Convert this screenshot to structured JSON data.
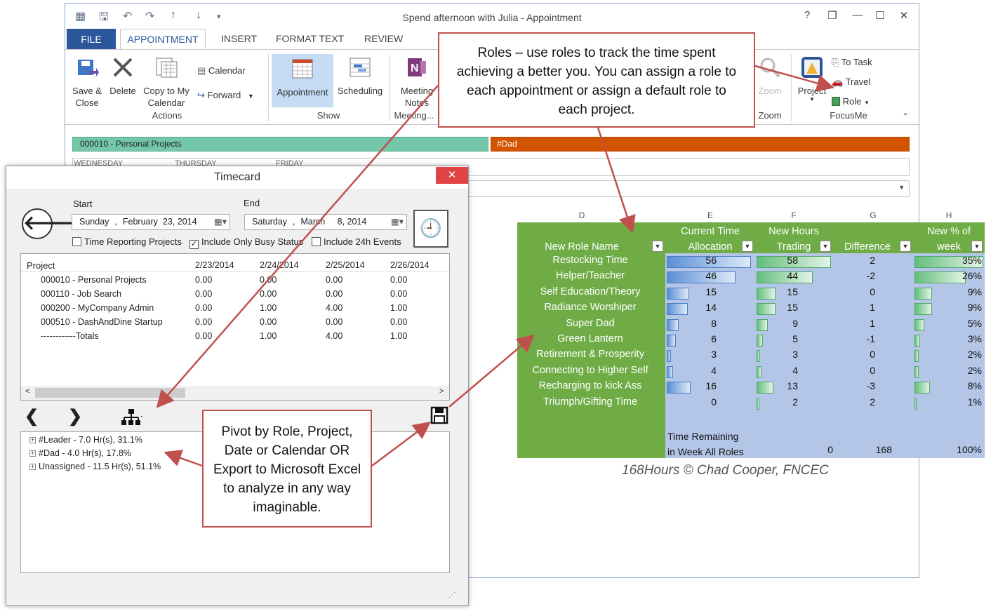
{
  "outlook": {
    "title": "Spend afternoon with Julia - Appointment",
    "tabs": [
      "FILE",
      "APPOINTMENT",
      "INSERT",
      "FORMAT TEXT",
      "REVIEW"
    ],
    "window_controls": [
      "?",
      "❐",
      "—",
      "☐",
      "✕"
    ],
    "ribbon": {
      "save_close": [
        "Save &",
        "Close"
      ],
      "delete": "Delete",
      "copy_to_calendar": [
        "Copy to My",
        "Calendar"
      ],
      "calendar": "Calendar",
      "forward": "Forward",
      "group_actions": "Actions",
      "appointment": "Appointment",
      "scheduling": "Scheduling",
      "group_show": "Show",
      "meeting_notes": [
        "Meeting",
        "Notes"
      ],
      "group_meeting": "Meeting...",
      "zoom_btn": "Zoom",
      "group_zoom": "Zoom",
      "project": "Project",
      "to_task": "To Task",
      "travel": "Travel",
      "role": "Role",
      "group_focusme": "FocusMe"
    },
    "project_bar": "000010 - Personal Projects",
    "role_bar": "#Dad",
    "day_labels": [
      "WEDNESDAY",
      "THURSDAY",
      "FRIDAY"
    ]
  },
  "timecard": {
    "title": "Timecard",
    "start_label": "Start",
    "end_label": "End",
    "start_date": {
      "weekday": "Sunday",
      "month": "February",
      "day": "23, 2014"
    },
    "end_date": {
      "weekday": "Saturday",
      "month": "March",
      "day": "8, 2014"
    },
    "checkboxes": [
      {
        "label": "Time Reporting Projects",
        "checked": false
      },
      {
        "label": "Include Only Busy Status",
        "checked": true
      },
      {
        "label": "Include 24h Events",
        "checked": false
      }
    ],
    "grid": {
      "headers": [
        "Project",
        "2/23/2014",
        "2/24/2014",
        "2/25/2014",
        "2/26/2014"
      ],
      "rows": [
        [
          "000010 - Personal Projects",
          "0.00",
          "0.00",
          "0.00",
          "0.00"
        ],
        [
          "000110 - Job Search",
          "0.00",
          "0.00",
          "0.00",
          "0.00"
        ],
        [
          "000200 - MyCompany Admin",
          "0.00",
          "1.00",
          "4.00",
          "1.00"
        ],
        [
          "000510 - DashAndDine Startup",
          "0.00",
          "0.00",
          "0.00",
          "0.00"
        ],
        [
          "------------Totals",
          "0.00",
          "1.00",
          "4.00",
          "1.00"
        ]
      ]
    },
    "tree": [
      "#Leader - 7.0 Hr(s), 31.1%",
      "#Dad - 4.0 Hr(s), 17.8%",
      "Unassigned - 11.5 Hr(s), 51.1%"
    ]
  },
  "callouts": {
    "roles": "Roles – use roles to track the time spent achieving a better you.  You can assign a role to each appointment or assign a default role to each project.",
    "pivot": "Pivot by Role, Project, Date or Calendar OR Export to Microsoft Excel to analyze in any way imaginable."
  },
  "excel": {
    "columns": [
      "D",
      "E",
      "F",
      "G",
      "H"
    ],
    "headers": {
      "role": "New Role Name",
      "current": [
        "Current Time",
        "Allocation"
      ],
      "new_hours": [
        "New Hours",
        "Trading"
      ],
      "difference": "Difference",
      "pct": [
        "New % of",
        "week"
      ]
    },
    "rows": [
      {
        "name": "Restocking Time",
        "current": 56,
        "new": 58,
        "diff": 2,
        "pct": "35%",
        "pct_value": 35
      },
      {
        "name": "Helper/Teacher",
        "current": 46,
        "new": 44,
        "diff": -2,
        "pct": "26%",
        "pct_value": 26
      },
      {
        "name": "Self Education/Theory",
        "current": 15,
        "new": 15,
        "diff": 0,
        "pct": "9%",
        "pct_value": 9
      },
      {
        "name": "Radiance Worshiper",
        "current": 14,
        "new": 15,
        "diff": 1,
        "pct": "9%",
        "pct_value": 9
      },
      {
        "name": "Super Dad",
        "current": 8,
        "new": 9,
        "diff": 1,
        "pct": "5%",
        "pct_value": 5
      },
      {
        "name": "Green Lantern",
        "current": 6,
        "new": 5,
        "diff": -1,
        "pct": "3%",
        "pct_value": 3
      },
      {
        "name": "Retirement & Prosperity",
        "current": 3,
        "new": 3,
        "diff": 0,
        "pct": "2%",
        "pct_value": 2
      },
      {
        "name": "Connecting to Higher Self",
        "current": 4,
        "new": 4,
        "diff": 0,
        "pct": "2%",
        "pct_value": 2
      },
      {
        "name": "Recharging to kick Ass",
        "current": 16,
        "new": 13,
        "diff": -3,
        "pct": "8%",
        "pct_value": 8
      },
      {
        "name": "Triumph/Gifting Time",
        "current": 0,
        "new": 2,
        "diff": 2,
        "pct": "1%",
        "pct_value": 1
      }
    ],
    "remaining_label": [
      "Time Remaining",
      "in Week All Roles"
    ],
    "remaining_current": "0",
    "remaining_new": "168",
    "remaining_pct": "100%",
    "bar_max": 58,
    "colors": {
      "green": "#6fac46",
      "blue_fill": "#b4c6e7",
      "bar_blue": "#5b8fd6",
      "bar_green": "#63be7b"
    }
  },
  "credit": "168Hours © Chad Cooper, FNCEC"
}
